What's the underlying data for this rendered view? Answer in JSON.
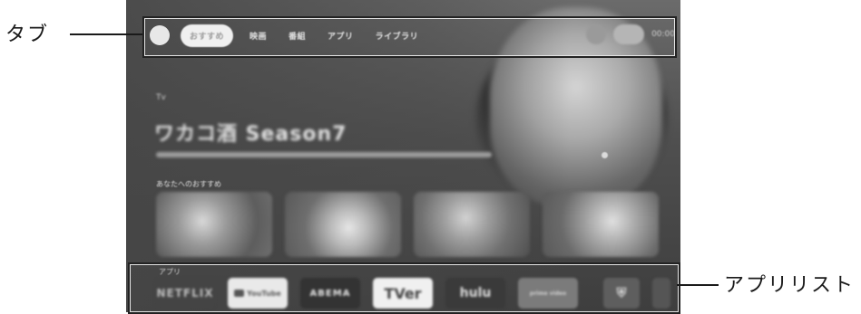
{
  "tv": {
    "tabs": [
      "おすすめ",
      "映画",
      "番組",
      "アプリ",
      "ライブラリ"
    ],
    "active_tab_index": 0,
    "clock": "00:00",
    "hero": {
      "small_label": "Tv",
      "title": "ワカコ酒 Season7"
    },
    "recommend_label": "あなたへのおすすめ",
    "apps_label": "アプリ",
    "apps": [
      {
        "name": "NETFLIX",
        "icon": "netflix-logo"
      },
      {
        "name": "YouTube",
        "icon": "youtube-logo"
      },
      {
        "name": "ABEMA",
        "icon": "abema-logo"
      },
      {
        "name": "TVer",
        "icon": "tver-logo"
      },
      {
        "name": "hulu",
        "icon": "hulu-logo"
      },
      {
        "name": "prime video",
        "icon": "prime-video-logo"
      }
    ]
  },
  "annotations": {
    "tab_label": "タブ",
    "apps_label": "アプリリスト"
  }
}
